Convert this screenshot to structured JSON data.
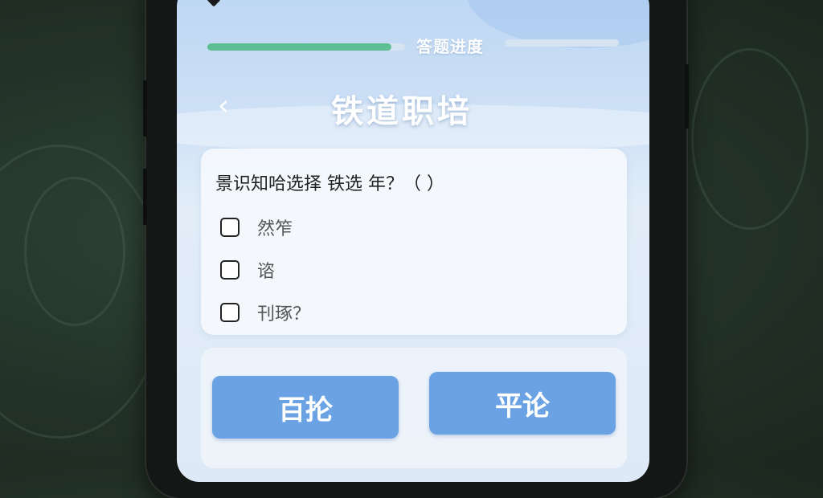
{
  "progress": {
    "label": "答题进度",
    "fraction": 0.93
  },
  "header": {
    "back_icon": "chevron-left-icon",
    "back_glyph": "‹",
    "title": "铁道职培"
  },
  "question": {
    "text": "景识知哈选择 铁选 年？（ ）",
    "options": [
      {
        "label": "然笮",
        "checked": false
      },
      {
        "label": "谘",
        "checked": false
      },
      {
        "label": "刊琢？",
        "checked": false
      }
    ]
  },
  "actions": {
    "left_label": "百抡",
    "right_label": "平论"
  },
  "colors": {
    "progress_fill": "#5fbf94",
    "button": "#6aa2e3",
    "screen_top": "#bcd6f3"
  }
}
